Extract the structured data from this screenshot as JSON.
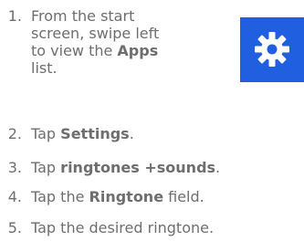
{
  "steps": [
    {
      "number": "1.",
      "parts": [
        "From the start screen, swipe left to view the ",
        "Apps",
        " list."
      ]
    },
    {
      "number": "2.",
      "parts": [
        "Tap ",
        "Settings",
        "."
      ]
    },
    {
      "number": "3.",
      "parts": [
        "Tap ",
        "ringtones +sounds",
        "."
      ]
    },
    {
      "number": "4.",
      "parts": [
        "Tap the ",
        "Ringtone",
        " field."
      ]
    },
    {
      "number": "5.",
      "parts": [
        "Tap the desired ringtone."
      ]
    }
  ],
  "settings_icon": {
    "name": "gear-icon",
    "tile_color": "#1f5fe0",
    "glyph_color": "#ffffff"
  },
  "text_color": "#6e6e6e"
}
